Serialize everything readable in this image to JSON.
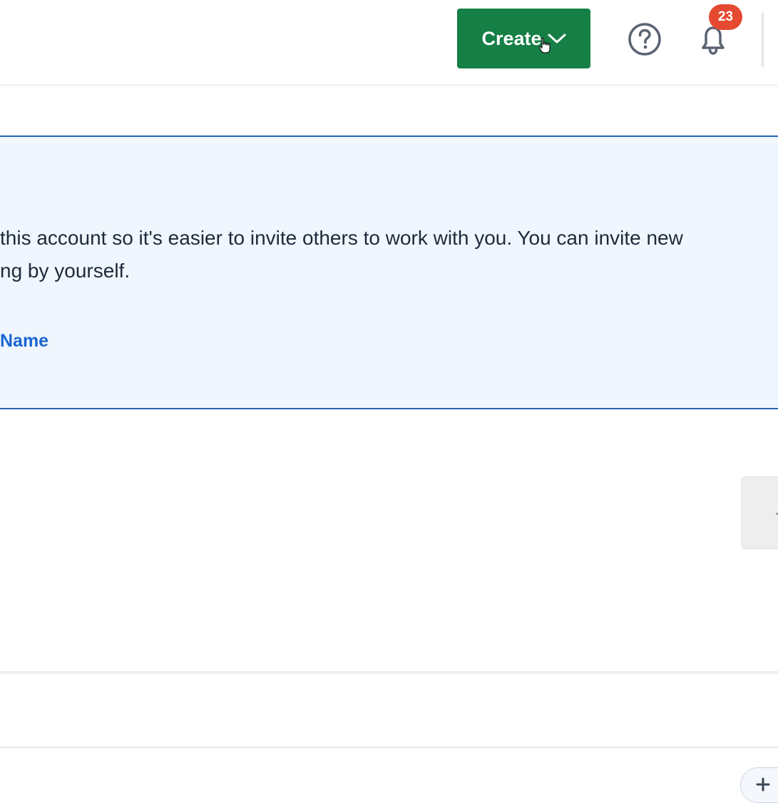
{
  "header": {
    "create_label": "Create",
    "help_icon": "question-circle-icon",
    "notifications_icon": "bell-icon",
    "notifications_count": "23",
    "create_color": "#157f45",
    "badge_color": "#e5492f"
  },
  "banner": {
    "line1": " this account so it's easier to invite others to work with you. You can invite new",
    "line2": "ng by yourself.",
    "link_label": "Name",
    "background": "#eff6fd",
    "border_color": "#2864b4",
    "link_color": "#1a66d2"
  },
  "footer": {
    "add_icon": "plus-icon"
  }
}
